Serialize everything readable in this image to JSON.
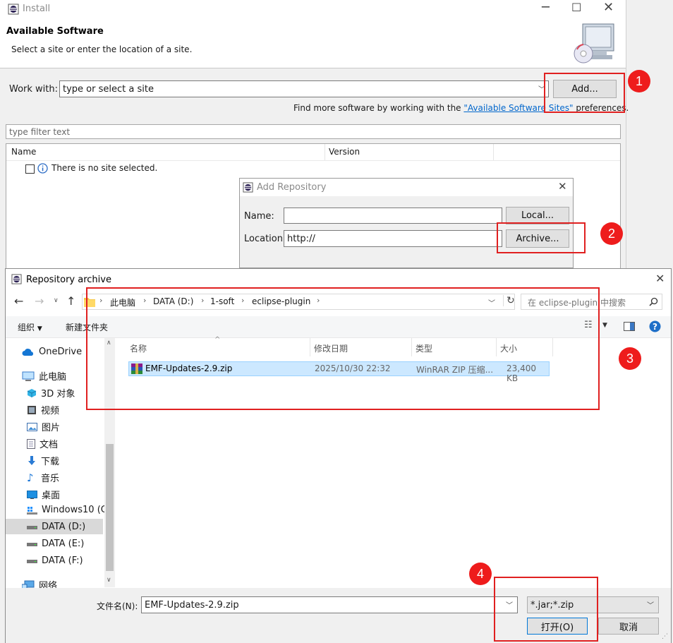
{
  "install": {
    "title": "Install",
    "heading": "Available Software",
    "subheading": "Select a site or enter the location of a site.",
    "work_with_label": "Work with:",
    "work_with_placeholder": "type or select a site",
    "add_button": "Add...",
    "find_more_prefix": "Find more software by working with the ",
    "find_more_link": "\"Available Software Sites\"",
    "find_more_suffix": " preferences.",
    "filter_placeholder": "type filter text",
    "columns": [
      "Name",
      "Version"
    ],
    "empty_message": "There is no site selected."
  },
  "add_repo": {
    "title": "Add Repository",
    "name_label": "Name:",
    "name_value": "",
    "location_label": "Location:",
    "location_value": "http://",
    "local_button": "Local...",
    "archive_button": "Archive..."
  },
  "file_dialog": {
    "title": "Repository archive",
    "breadcrumb": [
      "此电脑",
      "DATA (D:)",
      "1-soft",
      "eclipse-plugin"
    ],
    "search_placeholder": "在 eclipse-plugin 中搜索",
    "organize": "组织",
    "new_folder": "新建文件夹",
    "nav": [
      {
        "label": "OneDrive",
        "icon": "cloud-icon"
      },
      {
        "label": "此电脑",
        "icon": "computer-icon"
      },
      {
        "label": "3D 对象",
        "icon": "cube-icon"
      },
      {
        "label": "视频",
        "icon": "video-icon"
      },
      {
        "label": "图片",
        "icon": "picture-icon"
      },
      {
        "label": "文档",
        "icon": "document-icon"
      },
      {
        "label": "下载",
        "icon": "download-icon"
      },
      {
        "label": "音乐",
        "icon": "music-icon"
      },
      {
        "label": "桌面",
        "icon": "desktop-icon"
      },
      {
        "label": "Windows10 (C:",
        "icon": "drive-windows-icon"
      },
      {
        "label": "DATA (D:)",
        "icon": "drive-icon"
      },
      {
        "label": "DATA (E:)",
        "icon": "drive-icon"
      },
      {
        "label": "DATA (F:)",
        "icon": "drive-icon"
      },
      {
        "label": "网络",
        "icon": "network-icon"
      }
    ],
    "columns": [
      "名称",
      "修改日期",
      "类型",
      "大小"
    ],
    "files": [
      {
        "name": "EMF-Updates-2.9.zip",
        "date": "2025/10/30 22:32",
        "type": "WinRAR ZIP 压缩...",
        "size": "23,400 KB"
      }
    ],
    "filename_label": "文件名(N):",
    "filename_value": "EMF-Updates-2.9.zip",
    "filter_value": "*.jar;*.zip",
    "open_button": "打开(O)",
    "cancel_button": "取消"
  },
  "annotations": [
    "1",
    "2",
    "3",
    "4"
  ],
  "colors": {
    "annotation_red": "#e02020",
    "selection": "#cce8ff",
    "link": "#0066cc"
  }
}
